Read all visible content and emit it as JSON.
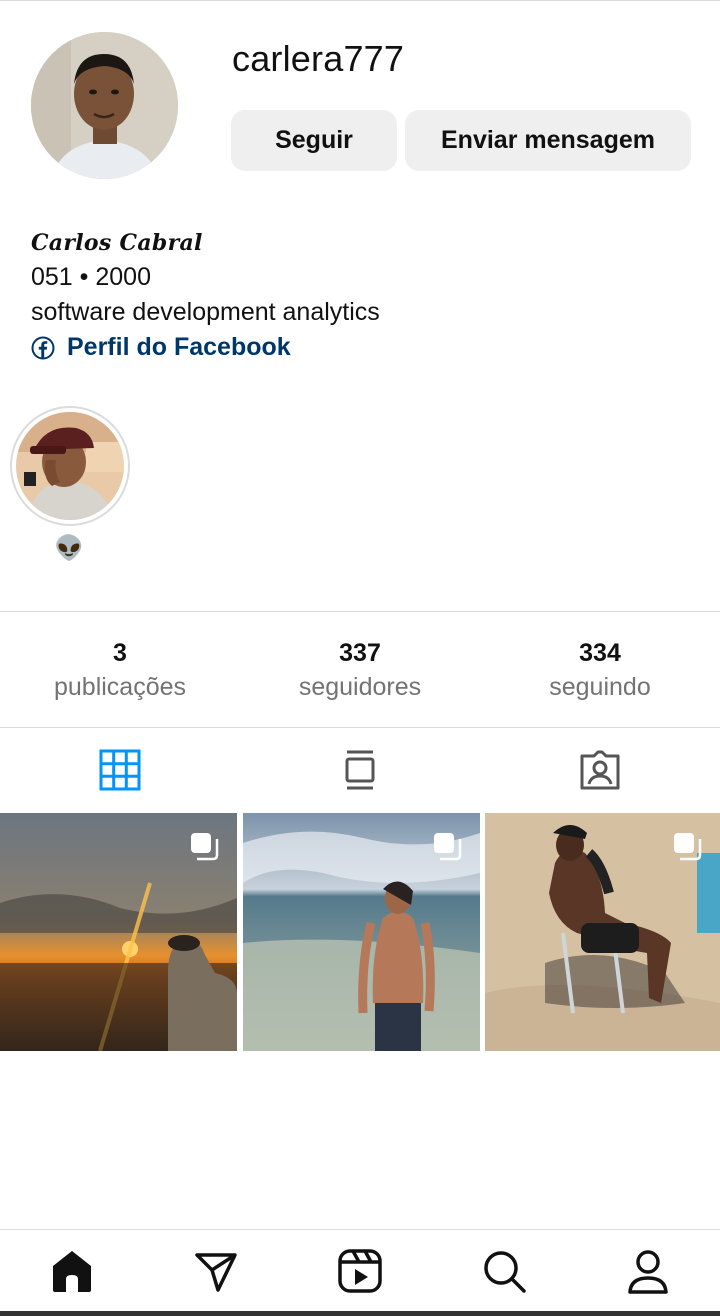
{
  "profile": {
    "username": "carlera777",
    "follow_label": "Seguir",
    "message_label": "Enviar mensagem"
  },
  "bio": {
    "name": "Carlos Cabral",
    "line1": "051 • 2000",
    "line2": "software development analytics",
    "link_label": "Perfil do Facebook",
    "link_icon": "facebook-icon"
  },
  "highlights": [
    {
      "label": "👽"
    }
  ],
  "stats": {
    "posts": {
      "value": "3",
      "label": "publicações"
    },
    "followers": {
      "value": "337",
      "label": "seguidores"
    },
    "following": {
      "value": "334",
      "label": "seguindo"
    }
  },
  "tabs": [
    {
      "icon": "grid-icon",
      "active": true
    },
    {
      "icon": "feed-icon",
      "active": false
    },
    {
      "icon": "tagged-icon",
      "active": false
    }
  ],
  "nav": [
    {
      "icon": "home-icon"
    },
    {
      "icon": "direct-icon"
    },
    {
      "icon": "reels-icon"
    },
    {
      "icon": "search-icon"
    },
    {
      "icon": "profile-icon"
    }
  ],
  "colors": {
    "link": "#00376b",
    "accent": "#0095f6",
    "button_bg": "#efefef",
    "muted_text": "#737373"
  }
}
